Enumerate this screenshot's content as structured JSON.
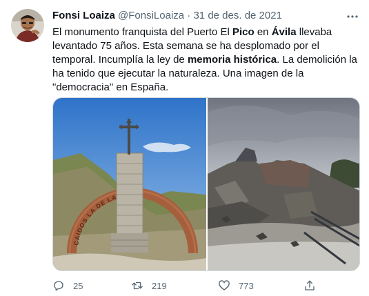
{
  "tweet": {
    "author_name": "Fonsi Loaiza",
    "handle": "@FonsiLoaiza",
    "separator": "·",
    "date": "31 de des. de 2021",
    "text": {
      "s1": "El monumento franquista del Puerto El ",
      "b1": "Pico",
      "s2": " en ",
      "b2": "Ávila",
      "s3": " llevaba levantado 75 años. Esta semana se ha desplomado por el temporal. Incumplía la ley de ",
      "b3": "memoria histórica",
      "s4": ". La demolición la ha tenido que ejecutar la naturaleza. Una imagen de la \"democracia\" en España."
    },
    "media": {
      "left_image_arch_text": "CAIDOS  LA  DE LA REGI"
    },
    "actions": {
      "replies": "25",
      "retweets": "219",
      "likes": "773"
    }
  },
  "colors": {
    "text_primary": "#0f1419",
    "text_secondary": "#536471",
    "border": "#cfd9de"
  },
  "icons": [
    "more-icon",
    "reply-icon",
    "retweet-icon",
    "like-icon",
    "share-icon"
  ]
}
